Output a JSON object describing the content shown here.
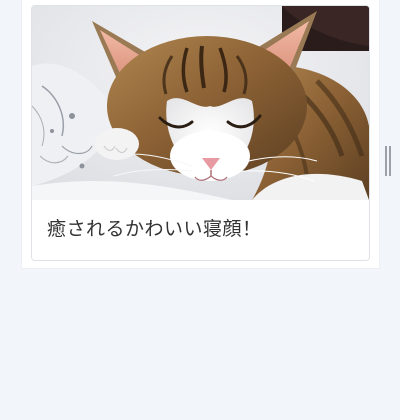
{
  "card": {
    "image": {
      "subject": "sleeping-tabby-white-cat"
    },
    "caption": "癒されるかわいい寝顔！"
  },
  "colors": {
    "page_background": "#f2f5f9",
    "card_background": "#ffffff",
    "card_border": "#dfe3e8",
    "caption_text": "#333333"
  }
}
